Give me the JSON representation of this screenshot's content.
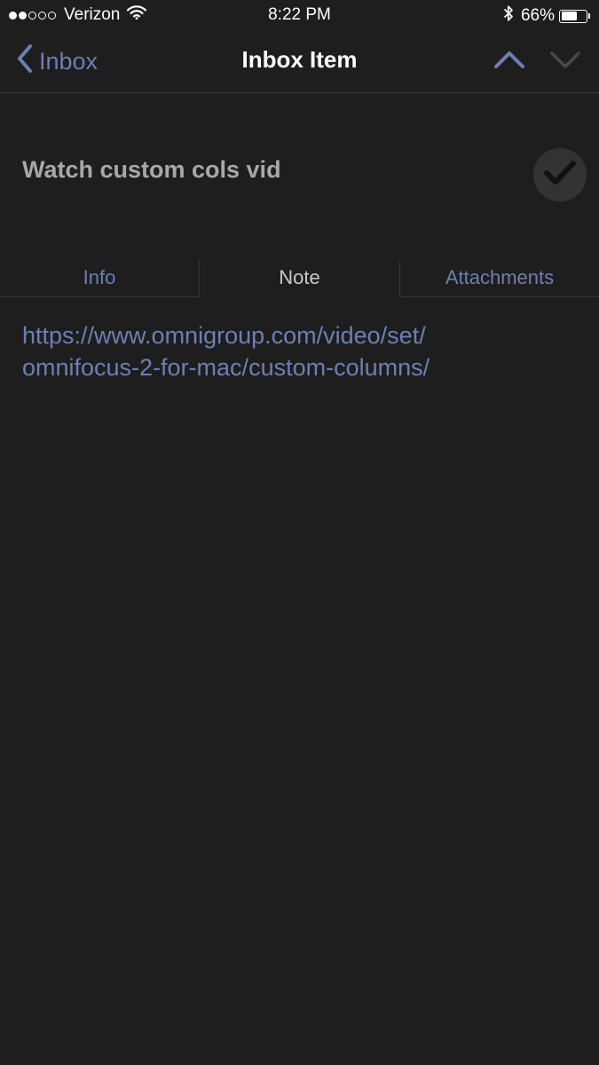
{
  "status_bar": {
    "carrier": "Verizon",
    "time": "8:22 PM",
    "battery": "66%",
    "battery_level": 0.66,
    "signal_bars": 2,
    "signal_max": 5,
    "icons": [
      "signal-dots-icon",
      "wifi-icon",
      "bluetooth-icon",
      "battery-icon"
    ]
  },
  "nav": {
    "back_label": "Inbox",
    "title": "Inbox Item",
    "icons": [
      "chevron-left-icon",
      "chevron-up-icon",
      "chevron-down-icon"
    ]
  },
  "task": {
    "title": "Watch custom cols vid",
    "icon": "checkmark-icon"
  },
  "tabs": [
    {
      "label": "Info",
      "selected": false
    },
    {
      "label": "Note",
      "selected": true
    },
    {
      "label": "Attachments",
      "selected": false
    }
  ],
  "note": {
    "line1": "https://www.omnigroup.com/video/set/",
    "line2": "omnifocus-2-for-mac/custom-columns/"
  },
  "colors": {
    "background": "#1e1e1e",
    "accent": "#6e7fb3",
    "text": "#ffffff",
    "muted_text": "#a8a8a8"
  }
}
